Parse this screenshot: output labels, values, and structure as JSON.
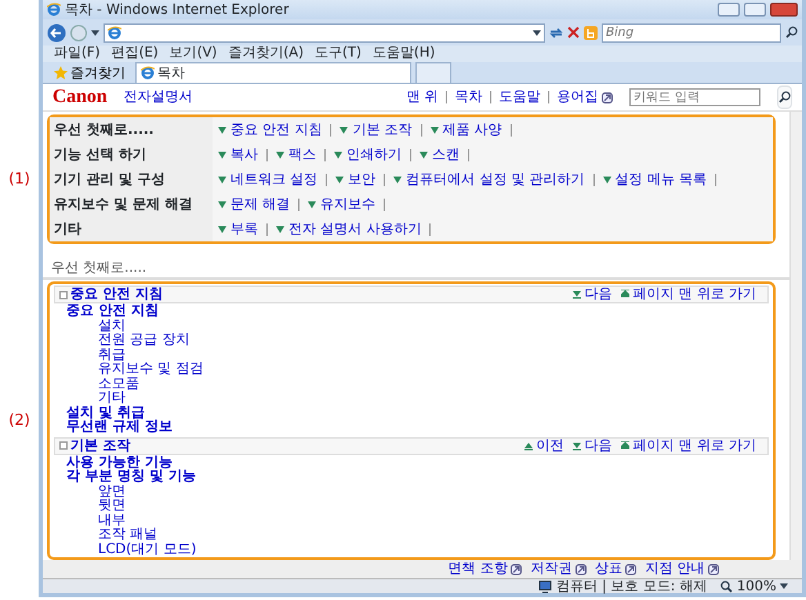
{
  "window": {
    "title": "목차 - Windows Internet Explorer"
  },
  "search_box": {
    "placeholder": "Bing"
  },
  "menu": [
    "파일(F)",
    "편집(E)",
    "보기(V)",
    "즐겨찾기(A)",
    "도구(T)",
    "도움말(H)"
  ],
  "favorites_button": "즐겨찾기",
  "tabs": [
    {
      "label": "목차",
      "selected": true
    }
  ],
  "header": {
    "logo": "Canon",
    "title": "전자설명서",
    "links": [
      "맨 위",
      "목차",
      "도움말",
      "용어집"
    ],
    "search": {
      "placeholder": "키워드 입력"
    }
  },
  "callouts": [
    "(1)",
    "(2)"
  ],
  "quick_nav": [
    {
      "heading": "우선 첫째로.....",
      "links": [
        "중요 안전 지침",
        "기본 조작",
        "제품 사양"
      ]
    },
    {
      "heading": "기능 선택 하기",
      "links": [
        "복사",
        "팩스",
        "인쇄하기",
        "스캔"
      ]
    },
    {
      "heading": "기기 관리 및 구성",
      "links": [
        "네트워크 설정",
        "보안",
        "컴퓨터에서 설정 및 관리하기",
        "설정 메뉴 목록"
      ]
    },
    {
      "heading": "유지보수 및 문제 해결",
      "links": [
        "문제 해결",
        "유지보수"
      ]
    },
    {
      "heading": "기타",
      "links": [
        "부록",
        "전자 설명서 사용하기"
      ]
    }
  ],
  "section_caption": "우선 첫째로.....",
  "sections": [
    {
      "title": "중요 안전 지침",
      "nav": [
        {
          "kind": "next",
          "label": "다음"
        },
        {
          "kind": "top",
          "label": "페이지 맨 위로 가기"
        }
      ],
      "items": [
        {
          "label": "중요 안전 지침",
          "children": [
            {
              "label": "설치"
            },
            {
              "label": "전원 공급 장치"
            },
            {
              "label": "취급"
            },
            {
              "label": "유지보수 및 점검"
            },
            {
              "label": "소모품"
            },
            {
              "label": "기타"
            }
          ]
        },
        {
          "label": "설치 및 취급"
        },
        {
          "label": "무선랜 규제 정보"
        }
      ]
    },
    {
      "title": "기본 조작",
      "nav": [
        {
          "kind": "prev",
          "label": "이전"
        },
        {
          "kind": "next",
          "label": "다음"
        },
        {
          "kind": "top",
          "label": "페이지 맨 위로 가기"
        }
      ],
      "items": [
        {
          "label": "사용 가능한 기능"
        },
        {
          "label": "각 부분 명칭 및 기능",
          "children": [
            {
              "label": "앞면"
            },
            {
              "label": "뒷면"
            },
            {
              "label": "내부"
            },
            {
              "label": "조작 패널"
            },
            {
              "label": "LCD(대기 모드)"
            }
          ]
        }
      ]
    }
  ],
  "footer_links": [
    "면책 조항",
    "저작권",
    "상표",
    "지점 안내"
  ],
  "status_bar": {
    "zone": "컴퓨터 | 보호 모드: 해제",
    "zoom": "100%"
  }
}
